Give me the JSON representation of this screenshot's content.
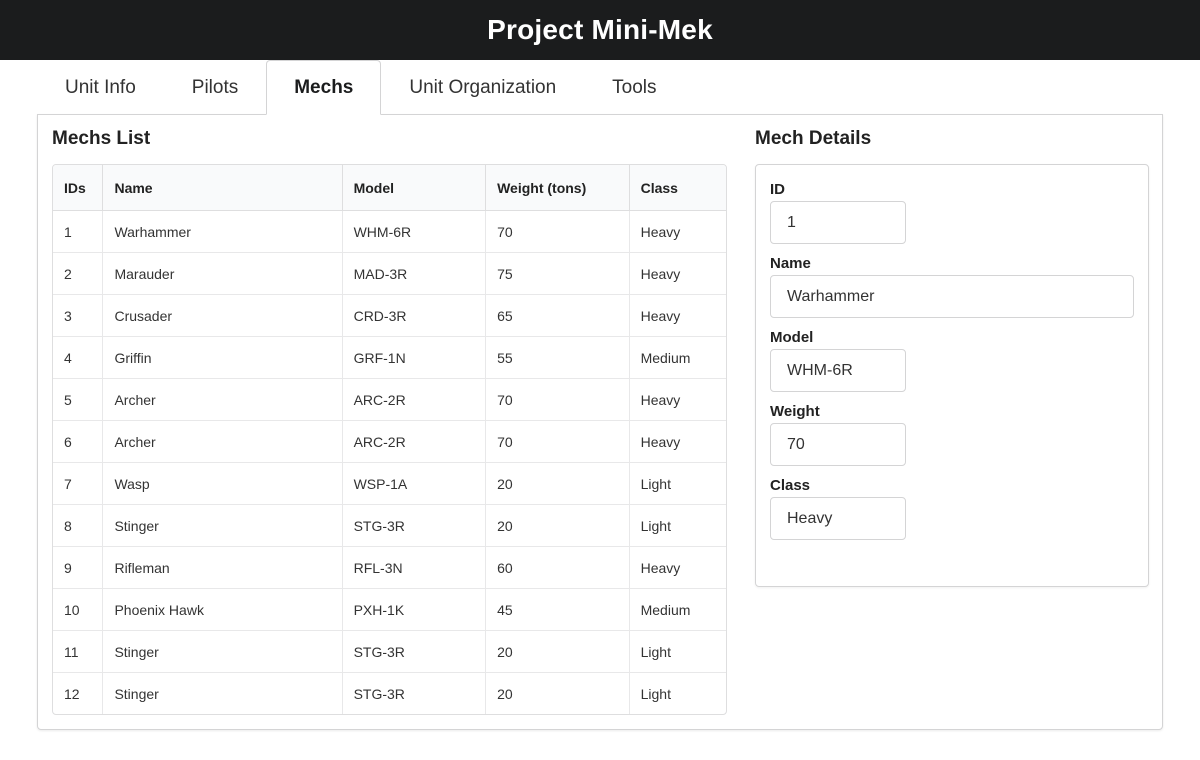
{
  "app": {
    "title": "Project Mini-Mek"
  },
  "tabs": [
    {
      "label": "Unit Info",
      "active": false
    },
    {
      "label": "Pilots",
      "active": false
    },
    {
      "label": "Mechs",
      "active": true
    },
    {
      "label": "Unit Organization",
      "active": false
    },
    {
      "label": "Tools",
      "active": false
    }
  ],
  "mechs_list": {
    "title": "Mechs List",
    "columns": [
      "IDs",
      "Name",
      "Model",
      "Weight (tons)",
      "Class"
    ],
    "rows": [
      [
        "1",
        "Warhammer",
        "WHM-6R",
        "70",
        "Heavy"
      ],
      [
        "2",
        "Marauder",
        "MAD-3R",
        "75",
        "Heavy"
      ],
      [
        "3",
        "Crusader",
        "CRD-3R",
        "65",
        "Heavy"
      ],
      [
        "4",
        "Griffin",
        "GRF-1N",
        "55",
        "Medium"
      ],
      [
        "5",
        "Archer",
        "ARC-2R",
        "70",
        "Heavy"
      ],
      [
        "6",
        "Archer",
        "ARC-2R",
        "70",
        "Heavy"
      ],
      [
        "7",
        "Wasp",
        "WSP-1A",
        "20",
        "Light"
      ],
      [
        "8",
        "Stinger",
        "STG-3R",
        "20",
        "Light"
      ],
      [
        "9",
        "Rifleman",
        "RFL-3N",
        "60",
        "Heavy"
      ],
      [
        "10",
        "Phoenix Hawk",
        "PXH-1K",
        "45",
        "Medium"
      ],
      [
        "11",
        "Stinger",
        "STG-3R",
        "20",
        "Light"
      ],
      [
        "12",
        "Stinger",
        "STG-3R",
        "20",
        "Light"
      ]
    ]
  },
  "mech_details": {
    "title": "Mech Details",
    "fields": {
      "id": {
        "label": "ID",
        "value": "1"
      },
      "name": {
        "label": "Name",
        "value": "Warhammer"
      },
      "model": {
        "label": "Model",
        "value": "WHM-6R"
      },
      "weight": {
        "label": "Weight",
        "value": "70"
      },
      "class": {
        "label": "Class",
        "value": "Heavy"
      }
    }
  }
}
